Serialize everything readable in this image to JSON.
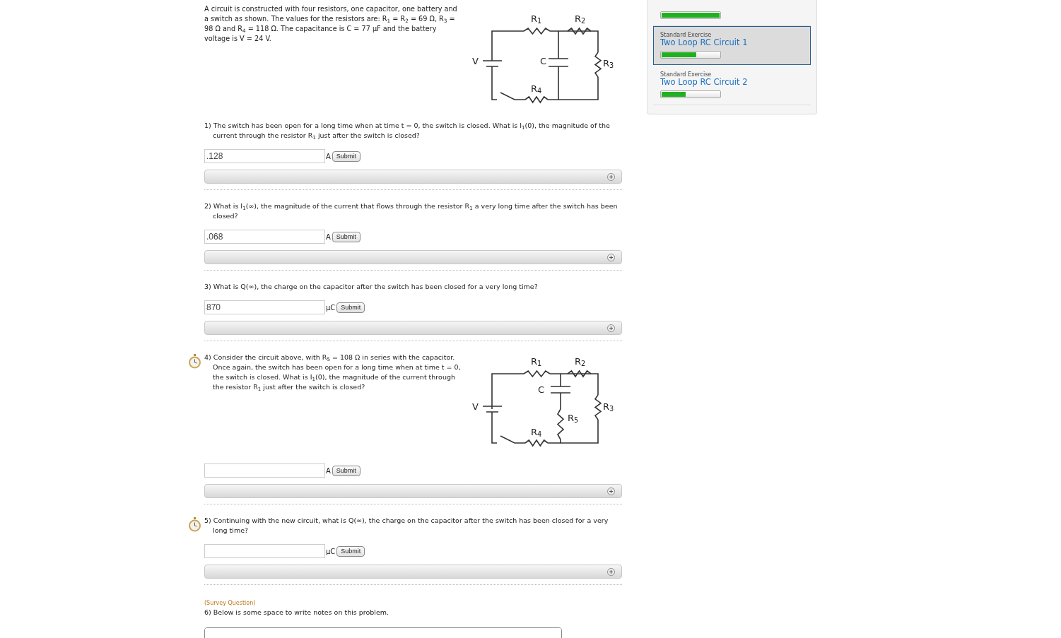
{
  "intro": {
    "text": "A circuit is constructed with four resistors, one capacitor, one battery and a switch as shown. The values for the resistors are: R$_{1}$ = R$_{2}$ = 69 Ω, R$_{3}$ = 98 Ω and R$_{4}$ = 118 Ω. The capacitance is C = 77 μF and the battery voltage is V = 24 V.",
    "circuit": {
      "kind": "basic",
      "labels": [
        "R$_{1}$",
        "R$_{2}$",
        "V",
        "C",
        "R$_{3}$",
        "R$_{4}$"
      ]
    }
  },
  "questions": [
    {
      "kind": "answer",
      "text": "1) The switch has been open for a long time when at time t = 0, the switch is closed. What is I$_{1}$(0), the magnitude of the current through the resistor R$_{1}$ just after the switch is closed?",
      "value": ".128",
      "unit": "A",
      "button": "Submit"
    },
    {
      "kind": "answer",
      "text": "2) What is I$_{1}$(∞), the magnitude of the current that flows through the resistor R$_{1}$ a very long time after the switch has been closed?",
      "value": ".068",
      "unit": "A",
      "button": "Submit"
    },
    {
      "kind": "answer",
      "text": "3) What is Q(∞), the charge on the capacitor after the switch has been closed for a very long time?",
      "value": "870",
      "unit": "μC",
      "button": "Submit"
    },
    {
      "kind": "timed_answer",
      "text": "4) Consider the circuit above, with R$_{5}$ = 108 Ω in series with the capacitor. Once again, the switch has been open for a long time when at time t = 0, the switch is closed. What is I$_{1}$(0), the magnitude of the current through the resistor R$_{1}$ just after the switch is closed?",
      "circuit": {
        "kind": "with_r5",
        "labels": [
          "R$_{1}$",
          "R$_{2}$",
          "C",
          "V",
          "R$_{3}$",
          "R$_{5}$",
          "R$_{4}$"
        ]
      },
      "unit": "A",
      "button": "Submit"
    },
    {
      "kind": "timed_answer",
      "text": "5) Continuing with the new circuit, what is Q(∞), the charge on the capacitor after the switch has been closed for a very long time?",
      "unit": "μC",
      "button": "Submit"
    },
    {
      "kind": "survey",
      "tag": "(Survey Question)",
      "text": "6) Below is some space to write notes on this problem."
    }
  ],
  "sidebar": {
    "items": [
      {
        "level": 1.0,
        "selected": false
      },
      {
        "type": "Standard Exercise",
        "title": "Two Loop RC Circuit 1",
        "level": 0.6,
        "selected": true
      },
      {
        "type": "Standard Exercise",
        "title": "Two Loop RC Circuit 2",
        "level": 0.41,
        "selected": false
      }
    ]
  }
}
